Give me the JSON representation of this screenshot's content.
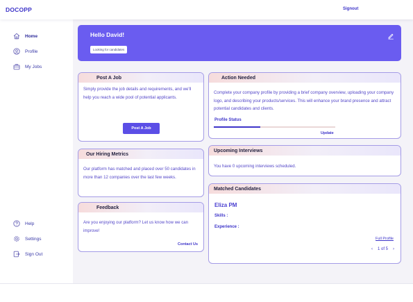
{
  "header": {
    "logo": "DOCOPP",
    "signout_label": "Signout"
  },
  "sidebar": {
    "top_items": [
      {
        "label": "Home",
        "icon": "home-icon",
        "active": true
      },
      {
        "label": "Profile",
        "icon": "profile-icon"
      },
      {
        "label": "My Jobs",
        "icon": "briefcase-icon"
      }
    ],
    "bottom_items": [
      {
        "label": "Help",
        "icon": "help-icon"
      },
      {
        "label": "Settings",
        "icon": "gear-icon"
      },
      {
        "label": "Sign Out",
        "icon": "sign-out-icon"
      }
    ]
  },
  "hero": {
    "greeting": "Hello David!",
    "status_badge": "Looking for candidates",
    "edit_icon": "edit-icon"
  },
  "post_job": {
    "title": "Post A Job",
    "description": "Simply provide the job details and requirements, and we'll help you reach a wide pool of potential applicants.",
    "button_label": "Post A Job"
  },
  "hiring_metrics": {
    "title": "Our Hiring Metrics",
    "description": "Our platform has matched and placed over 50 candidates in more than 12 companies over the last few weeks."
  },
  "feedback": {
    "title": "Feedback",
    "description": "Are you enjoying our platform? Let us know how we can improve!",
    "link_label": "Contact Us"
  },
  "action_needed": {
    "title": "Action Needed",
    "description": "Complete your company profile by providing a brief company overview, uploading your company logo, and describing your products/services. This will enhance your brand presence and attract potential candidates and clients.",
    "profile_status_label": "Profile Status",
    "profile_progress": 0.38,
    "update_label": "Update"
  },
  "upcoming_interviews": {
    "title": "Upcoming Interviews",
    "description": "You have 0 upcoming interviews scheduled."
  },
  "matched_candidates": {
    "title": "Matched Candidates",
    "candidate_name": "Eliza PM",
    "skills_label": "Skills :",
    "experience_label": "Experience :",
    "full_profile_label": "Full Profile",
    "page_text": "1 of 5",
    "prev_symbol": "‹",
    "next_symbol": "›"
  },
  "colors": {
    "accent": "#5b4ee6",
    "hero_bg": "#6a5cf0",
    "link": "#3d34c9",
    "card_border": "#a49be6"
  }
}
